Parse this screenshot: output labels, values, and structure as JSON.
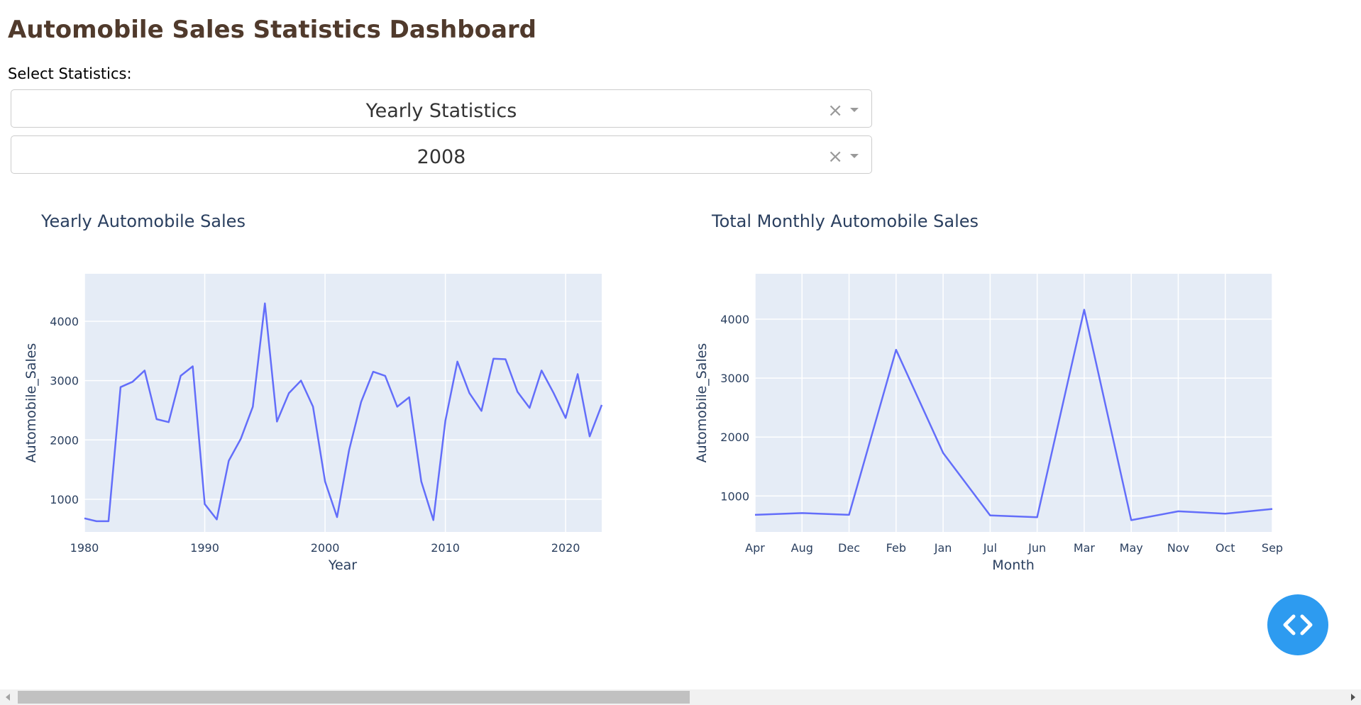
{
  "page": {
    "title": "Automobile Sales Statistics Dashboard"
  },
  "controls": {
    "select_label": "Select Statistics:",
    "statistics_dropdown": {
      "value": "Yearly Statistics"
    },
    "year_dropdown": {
      "value": "2008"
    },
    "clear_glyph": "×"
  },
  "colors": {
    "accent": "#636efa",
    "plot_background": "#e5ecf6",
    "title_color": "#503a2c",
    "fab": "#2d9bf0"
  },
  "icons": {
    "fab_icon": "code-brackets-icon",
    "clear_icon": "close-icon",
    "dropdown_icon": "chevron-down-icon"
  },
  "chart_data": [
    {
      "type": "line",
      "title": "Yearly Automobile Sales",
      "xlabel": "Year",
      "ylabel": "Automobile_Sales",
      "xlim": [
        1980,
        2023
      ],
      "ylim": [
        450,
        4800
      ],
      "xticks": [
        1980,
        1990,
        2000,
        2010,
        2020
      ],
      "yticks": [
        1000,
        2000,
        3000,
        4000
      ],
      "grid": true,
      "x": [
        1980,
        1981,
        1982,
        1983,
        1984,
        1985,
        1986,
        1987,
        1988,
        1989,
        1990,
        1991,
        1992,
        1993,
        1994,
        1995,
        1996,
        1997,
        1998,
        1999,
        2000,
        2001,
        2002,
        2003,
        2004,
        2005,
        2006,
        2007,
        2008,
        2009,
        2010,
        2011,
        2012,
        2013,
        2014,
        2015,
        2016,
        2017,
        2018,
        2019,
        2020,
        2021,
        2022,
        2023
      ],
      "y": [
        680,
        630,
        630,
        2890,
        2980,
        3170,
        2350,
        2300,
        3080,
        3240,
        920,
        660,
        1650,
        2020,
        2560,
        4300,
        2310,
        2790,
        3000,
        2560,
        1300,
        700,
        1830,
        2640,
        3150,
        3080,
        2560,
        2720,
        1300,
        650,
        2320,
        3320,
        2790,
        2490,
        3370,
        3360,
        2810,
        2540,
        3170,
        2790,
        2370,
        3110,
        2060,
        2590
      ]
    },
    {
      "type": "line",
      "title": "Total Monthly Automobile Sales",
      "xlabel": "Month",
      "ylabel": "Automobile_Sales",
      "categories": [
        "Apr",
        "Aug",
        "Dec",
        "Feb",
        "Jan",
        "Jul",
        "Jun",
        "Mar",
        "May",
        "Nov",
        "Oct",
        "Sep"
      ],
      "values": [
        680,
        710,
        680,
        3480,
        1730,
        670,
        640,
        4160,
        590,
        740,
        700,
        780
      ],
      "ylim": [
        390,
        4770
      ],
      "yticks": [
        1000,
        2000,
        3000,
        4000
      ],
      "grid": true
    }
  ]
}
